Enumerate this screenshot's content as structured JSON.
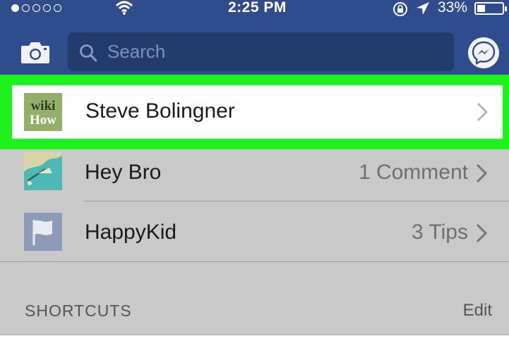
{
  "status_bar": {
    "time": "2:25 PM",
    "battery": "33%",
    "signal_dots_filled": 1,
    "signal_dots_total": 5,
    "icons": [
      "wifi-icon",
      "rotation-lock-icon",
      "location-arrow-icon",
      "battery-icon"
    ]
  },
  "header": {
    "search_placeholder": "Search",
    "left_icon": "camera-icon",
    "right_icon": "messenger-icon"
  },
  "list": {
    "items": [
      {
        "name": "Steve Bolingner",
        "meta": "",
        "thumb": "wikihow-logo",
        "highlighted": true
      },
      {
        "name": "Hey Bro",
        "meta": "1 Comment",
        "thumb": "drawing-thumbnail",
        "highlighted": false
      },
      {
        "name": "HappyKid",
        "meta": "3 Tips",
        "thumb": "flag-icon",
        "highlighted": false
      }
    ]
  },
  "thumb_text": {
    "line1": "wiki",
    "line2": "How"
  },
  "section": {
    "title": "SHORTCUTS",
    "action": "Edit"
  },
  "colors": {
    "nav_bar": "#2f4d8c",
    "search_bg": "#233b6d",
    "highlight": "#1df21d",
    "dimmed_bg": "#c9c9c9"
  }
}
